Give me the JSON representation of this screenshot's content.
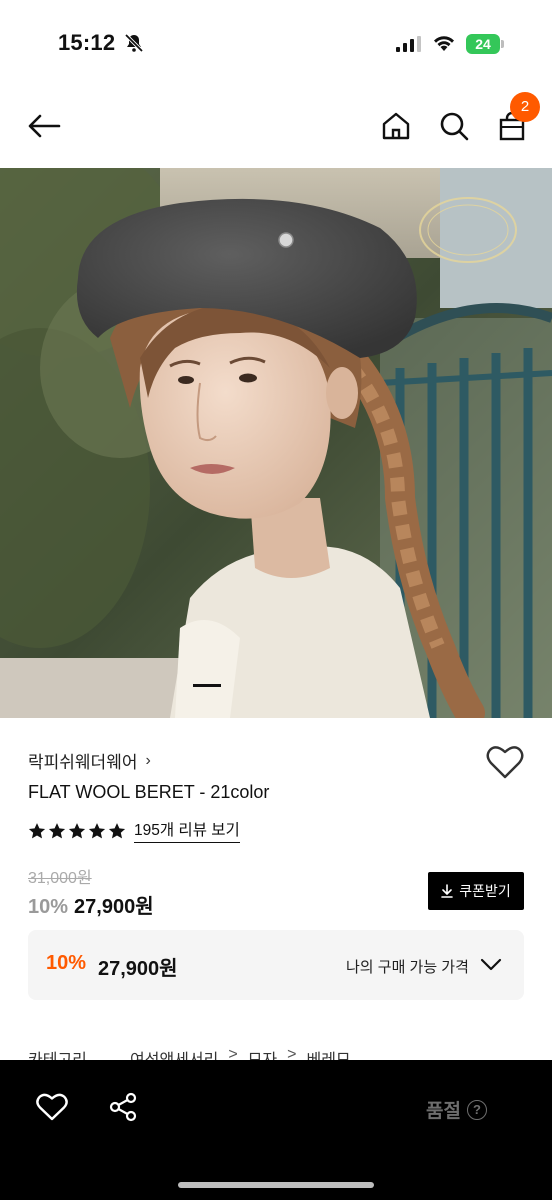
{
  "status_bar": {
    "time": "15:12",
    "battery": "24",
    "icons": [
      "bell-off-icon",
      "signal-icon",
      "wifi-icon",
      "battery-icon"
    ]
  },
  "header": {
    "cart_count": "2",
    "icons": [
      "back-arrow-icon",
      "home-icon",
      "search-icon",
      "cart-icon"
    ]
  },
  "hero": {
    "carousel_position": 1
  },
  "product": {
    "brand": "락피쉬웨더웨어",
    "brand_chevron": "›",
    "name": "FLAT WOOL BERET - 21color",
    "rating_stars": 5,
    "review_link": "195개 리뷰 보기",
    "original_price": "31,000원",
    "sale_rate": "10%",
    "sale_price": "27,900원",
    "coupon_button": "쿠폰받기"
  },
  "my_price": {
    "rate": "10%",
    "price": "27,900원",
    "label": "나의 구매 가능 가격"
  },
  "category": {
    "label": "카테고리",
    "path": [
      "여성액세서리",
      "모자",
      "베레모"
    ],
    "separator": ">"
  },
  "bottom_bar": {
    "status": "품절",
    "help": "?"
  },
  "colors": {
    "accent": "#ff5a00",
    "bottom_bar": "#000000",
    "muted": "#9a9a9a"
  }
}
